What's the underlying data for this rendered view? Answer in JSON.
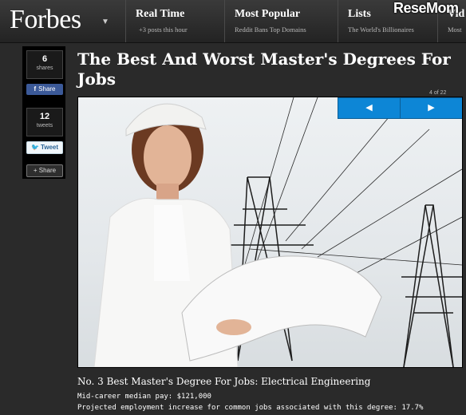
{
  "brand": {
    "logo": "Forbes",
    "watermark": "ReseMom"
  },
  "nav": [
    {
      "heading": "Real Time",
      "sub": "+3 posts this hour"
    },
    {
      "heading": "Most Popular",
      "sub": "Reddit Bans Top Domains"
    },
    {
      "heading": "Lists",
      "sub": "The World's Billionaires"
    },
    {
      "heading": "Vid",
      "sub": "Most"
    }
  ],
  "share": {
    "shares_count": "6",
    "shares_label": "shares",
    "facebook_label": "Share",
    "tweets_count": "12",
    "tweets_label": "tweets",
    "tweet_label": "Tweet",
    "more_label": "+ Share"
  },
  "article": {
    "title": "The Best And Worst Master's Degrees For Jobs",
    "slide_counter": "4 of 22",
    "prev_icon": "triangle-left-icon",
    "next_icon": "triangle-right-icon",
    "caption_title": "No. 3 Best Master's Degree For Jobs: Electrical Engineering",
    "caption_lines": [
      "Mid-career median pay: $121,000",
      "Projected employment increase for common jobs associated with this degree: 17.7%"
    ]
  },
  "colors": {
    "arrow_blue": "#0d86d6",
    "facebook": "#3b5998"
  }
}
